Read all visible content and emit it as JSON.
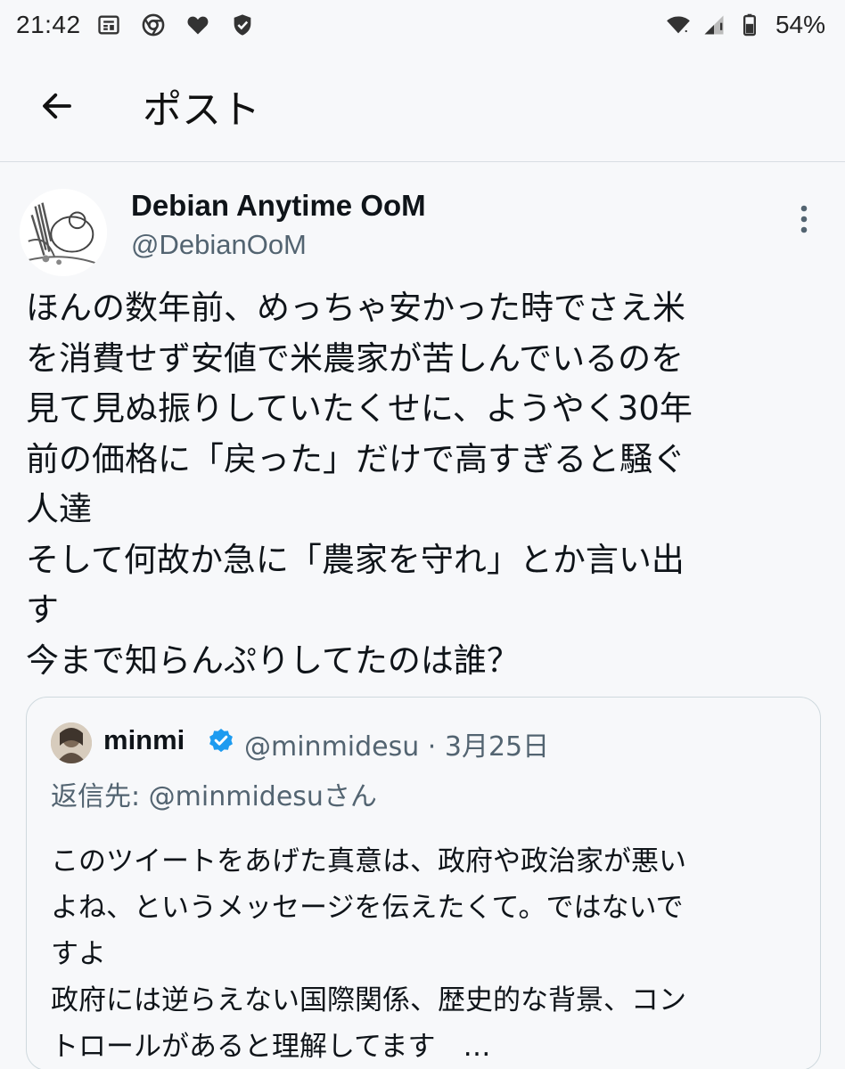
{
  "status_bar": {
    "time": "21:42",
    "left_icons": [
      "news-icon",
      "chrome-icon",
      "heart-icon",
      "shield-check-icon"
    ],
    "right_icons": [
      "wifi-icon",
      "signal-icon",
      "battery-icon"
    ],
    "battery": "54%"
  },
  "header": {
    "title": "ポスト"
  },
  "post": {
    "display_name": "Debian Anytime OoM",
    "handle": "@DebianOoM",
    "lines": [
      "ほんの数年前、めっちゃ安かった時でさえ米",
      "を消費せず安値で米農家が苦しんでいるのを",
      "見て見ぬ振りしていたくせに、ようやく30年",
      "前の価格に「戻った」だけで高すぎると騒ぐ",
      "人達",
      "そして何故か急に「農家を守れ」とか言い出",
      "す",
      "今まで知らんぷりしてたのは誰？"
    ]
  },
  "quote": {
    "name": "minmi",
    "meta": "@minmidesu · 3月25日",
    "reply_to": "返信先: @minmidesuさん",
    "lines": [
      "このツイートをあげた真意は、政府や政治家が悪い",
      "よね、というメッセージを伝えたくて。ではないで",
      "すよ",
      "政府には逆らえない国際関係、歴史的な背景、コン",
      "トロールがあると理解してます　…"
    ]
  },
  "colors": {
    "background": "#f7f8fa",
    "text": "#0f1419",
    "secondary": "#536471",
    "verified": "#1d9bf0",
    "border": "#cfd9de"
  }
}
